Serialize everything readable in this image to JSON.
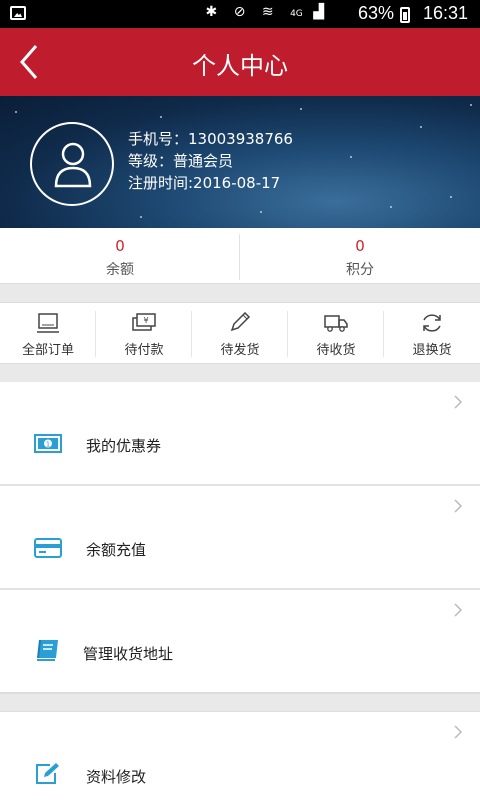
{
  "status_bar": {
    "battery": "63%",
    "time": "16:31",
    "network": "4G"
  },
  "header": {
    "title": "个人中心"
  },
  "profile": {
    "phone": "手机号：13003938766",
    "level": "等级：普通会员",
    "register": "注册时间:2016-08-17"
  },
  "balances": [
    {
      "value": "0",
      "label": "余额"
    },
    {
      "value": "0",
      "label": "积分"
    }
  ],
  "orders": [
    {
      "label": "全部订单",
      "icon": "all-orders-icon"
    },
    {
      "label": "待付款",
      "icon": "pending-payment-icon"
    },
    {
      "label": "待发货",
      "icon": "pending-shipment-icon"
    },
    {
      "label": "待收货",
      "icon": "pending-receipt-icon"
    },
    {
      "label": "退换货",
      "icon": "return-exchange-icon"
    }
  ],
  "menu": [
    {
      "label": "我的优惠券",
      "icon": "coupon-icon"
    },
    {
      "label": "余额充值",
      "icon": "card-icon"
    },
    {
      "label": "管理收货地址",
      "icon": "address-book-icon"
    },
    {
      "label": "资料修改",
      "icon": "edit-icon"
    }
  ],
  "colors": {
    "accent": "#bf1c2d",
    "icon_blue": "#2a9fd6",
    "value_red": "#d0222e"
  }
}
